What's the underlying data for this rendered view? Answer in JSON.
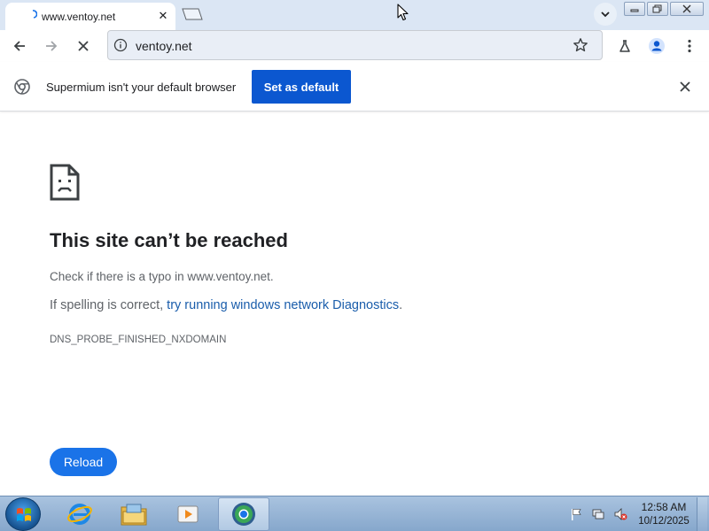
{
  "browser": {
    "tab": {
      "title": "www.ventoy.net"
    },
    "omnibox": {
      "url": "ventoy.net"
    }
  },
  "infobar": {
    "message": "Supermium isn't your default browser",
    "button": "Set as default"
  },
  "error_page": {
    "title": "This site can’t be reached",
    "line1": "Check if there is a typo in www.ventoy.net.",
    "line2_prefix": "If spelling is correct, ",
    "line2_link": "try running windows network Diagnostics",
    "line2_suffix": ".",
    "error_code": "DNS_PROBE_FINISHED_NXDOMAIN",
    "reload_button": "Reload"
  },
  "taskbar": {
    "apps": [
      {
        "icon": "internet-explorer-icon"
      },
      {
        "icon": "file-explorer-icon"
      },
      {
        "icon": "media-player-icon"
      },
      {
        "icon": "supermium-icon",
        "active": true
      }
    ],
    "clock": {
      "time": "12:58 AM",
      "date": "10/12/2025"
    }
  },
  "colors": {
    "accent": "#0b57d0",
    "link": "#1a5dab",
    "reload": "#1a73e8"
  }
}
